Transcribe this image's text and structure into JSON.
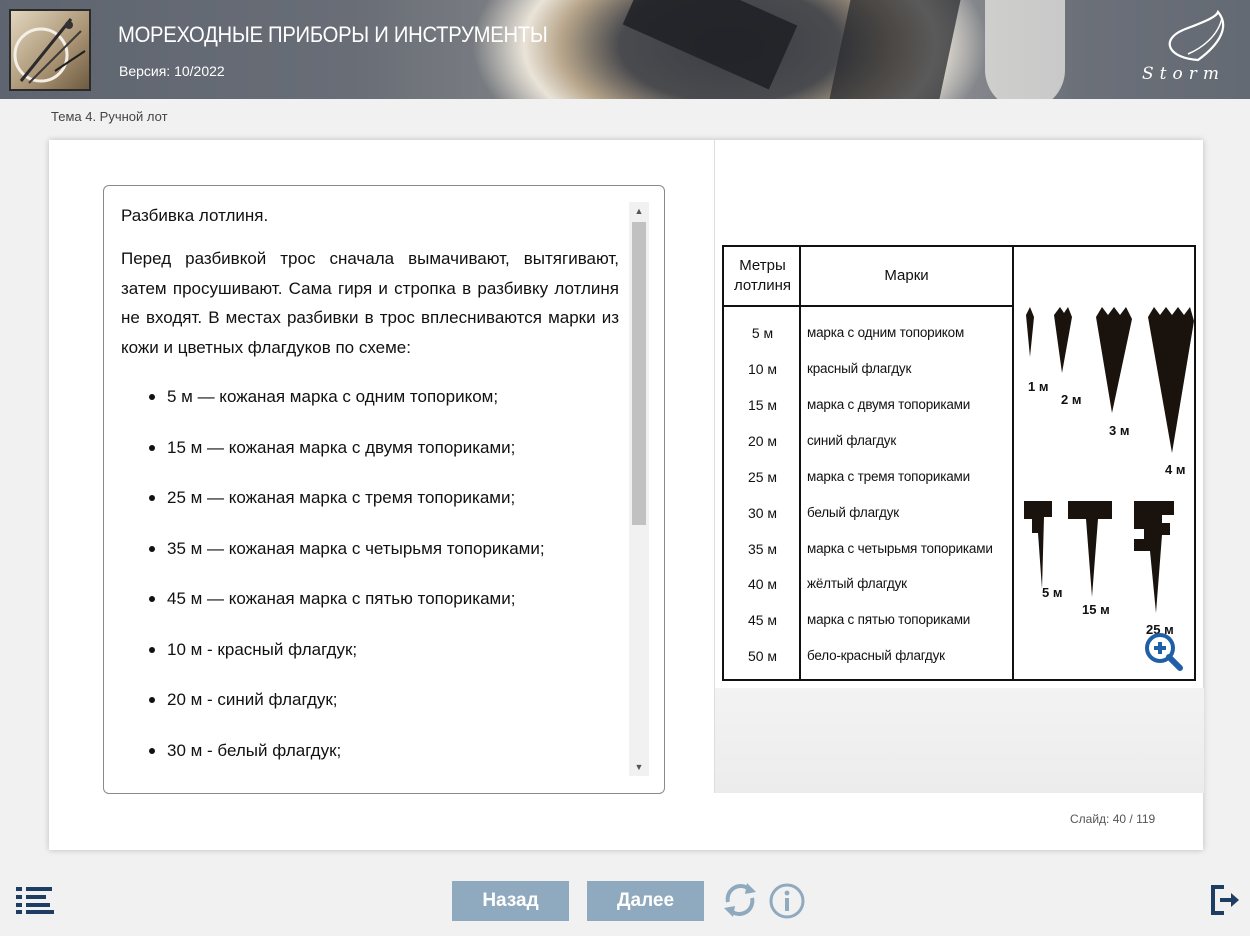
{
  "header": {
    "course_title": "МОРЕХОДНЫЕ ПРИБОРЫ И ИНСТРУМЕНТЫ",
    "version": "Версия: 10/2022",
    "logo_text": "Storm"
  },
  "breadcrumb": "Тема 4. Ручной лот",
  "content": {
    "title": "Разбивка лотлиня.",
    "paragraph": "Перед разбивкой трос сначала вымачивают, вытягивают, затем просушивают. Сама гиря и стропка в разбивку лотлиня не входят. В местах разбивки в трос вплесниваются марки из кожи и цветных флагдуков по схеме:",
    "list": [
      "5 м — кожаная марка с одним топориком;",
      "15 м — кожаная марка с двумя топориками;",
      "25 м — кожаная марка с тремя топориками;",
      "35 м — кожаная марка с четырьмя топориками;",
      "45 м — кожаная марка с пятью топориками;",
      "10 м - красный флагдук;",
      "20 м - синий флагдук;",
      "30 м - белый флагдук;"
    ]
  },
  "table": {
    "header_meters": "Метры лотлиня",
    "header_marks": "Марки",
    "rows": [
      {
        "m": "5 м",
        "mark": "марка с одним топориком"
      },
      {
        "m": "10 м",
        "mark": "красный флагдук"
      },
      {
        "m": "15 м",
        "mark": "марка с двумя топориками"
      },
      {
        "m": "20 м",
        "mark": "синий флагдук"
      },
      {
        "m": "25 м",
        "mark": "марка с тремя топориками"
      },
      {
        "m": "30 м",
        "mark": "белый флагдук"
      },
      {
        "m": "35 м",
        "mark": "марка с четырьмя топориками"
      },
      {
        "m": "40 м",
        "mark": "жёлтый флагдук"
      },
      {
        "m": "45 м",
        "mark": "марка с пятью топориками"
      },
      {
        "m": "50 м",
        "mark": "бело-красный флагдук"
      }
    ],
    "pic_labels": [
      "1 м",
      "2 м",
      "3 м",
      "4 м",
      "5 м",
      "15 м",
      "25 м"
    ]
  },
  "slide_counter": "Слайд:  40 / 119",
  "nav": {
    "back_label": "Назад",
    "next_label": "Далее"
  },
  "icons": {
    "menu": "menu-list-icon",
    "reload": "reload-icon",
    "info": "info-icon",
    "exit": "exit-icon",
    "zoom": "zoom-in-icon"
  },
  "colors": {
    "button": "#8fa9be",
    "icon": "#1e3d63",
    "zoom": "#1f5fa8"
  }
}
